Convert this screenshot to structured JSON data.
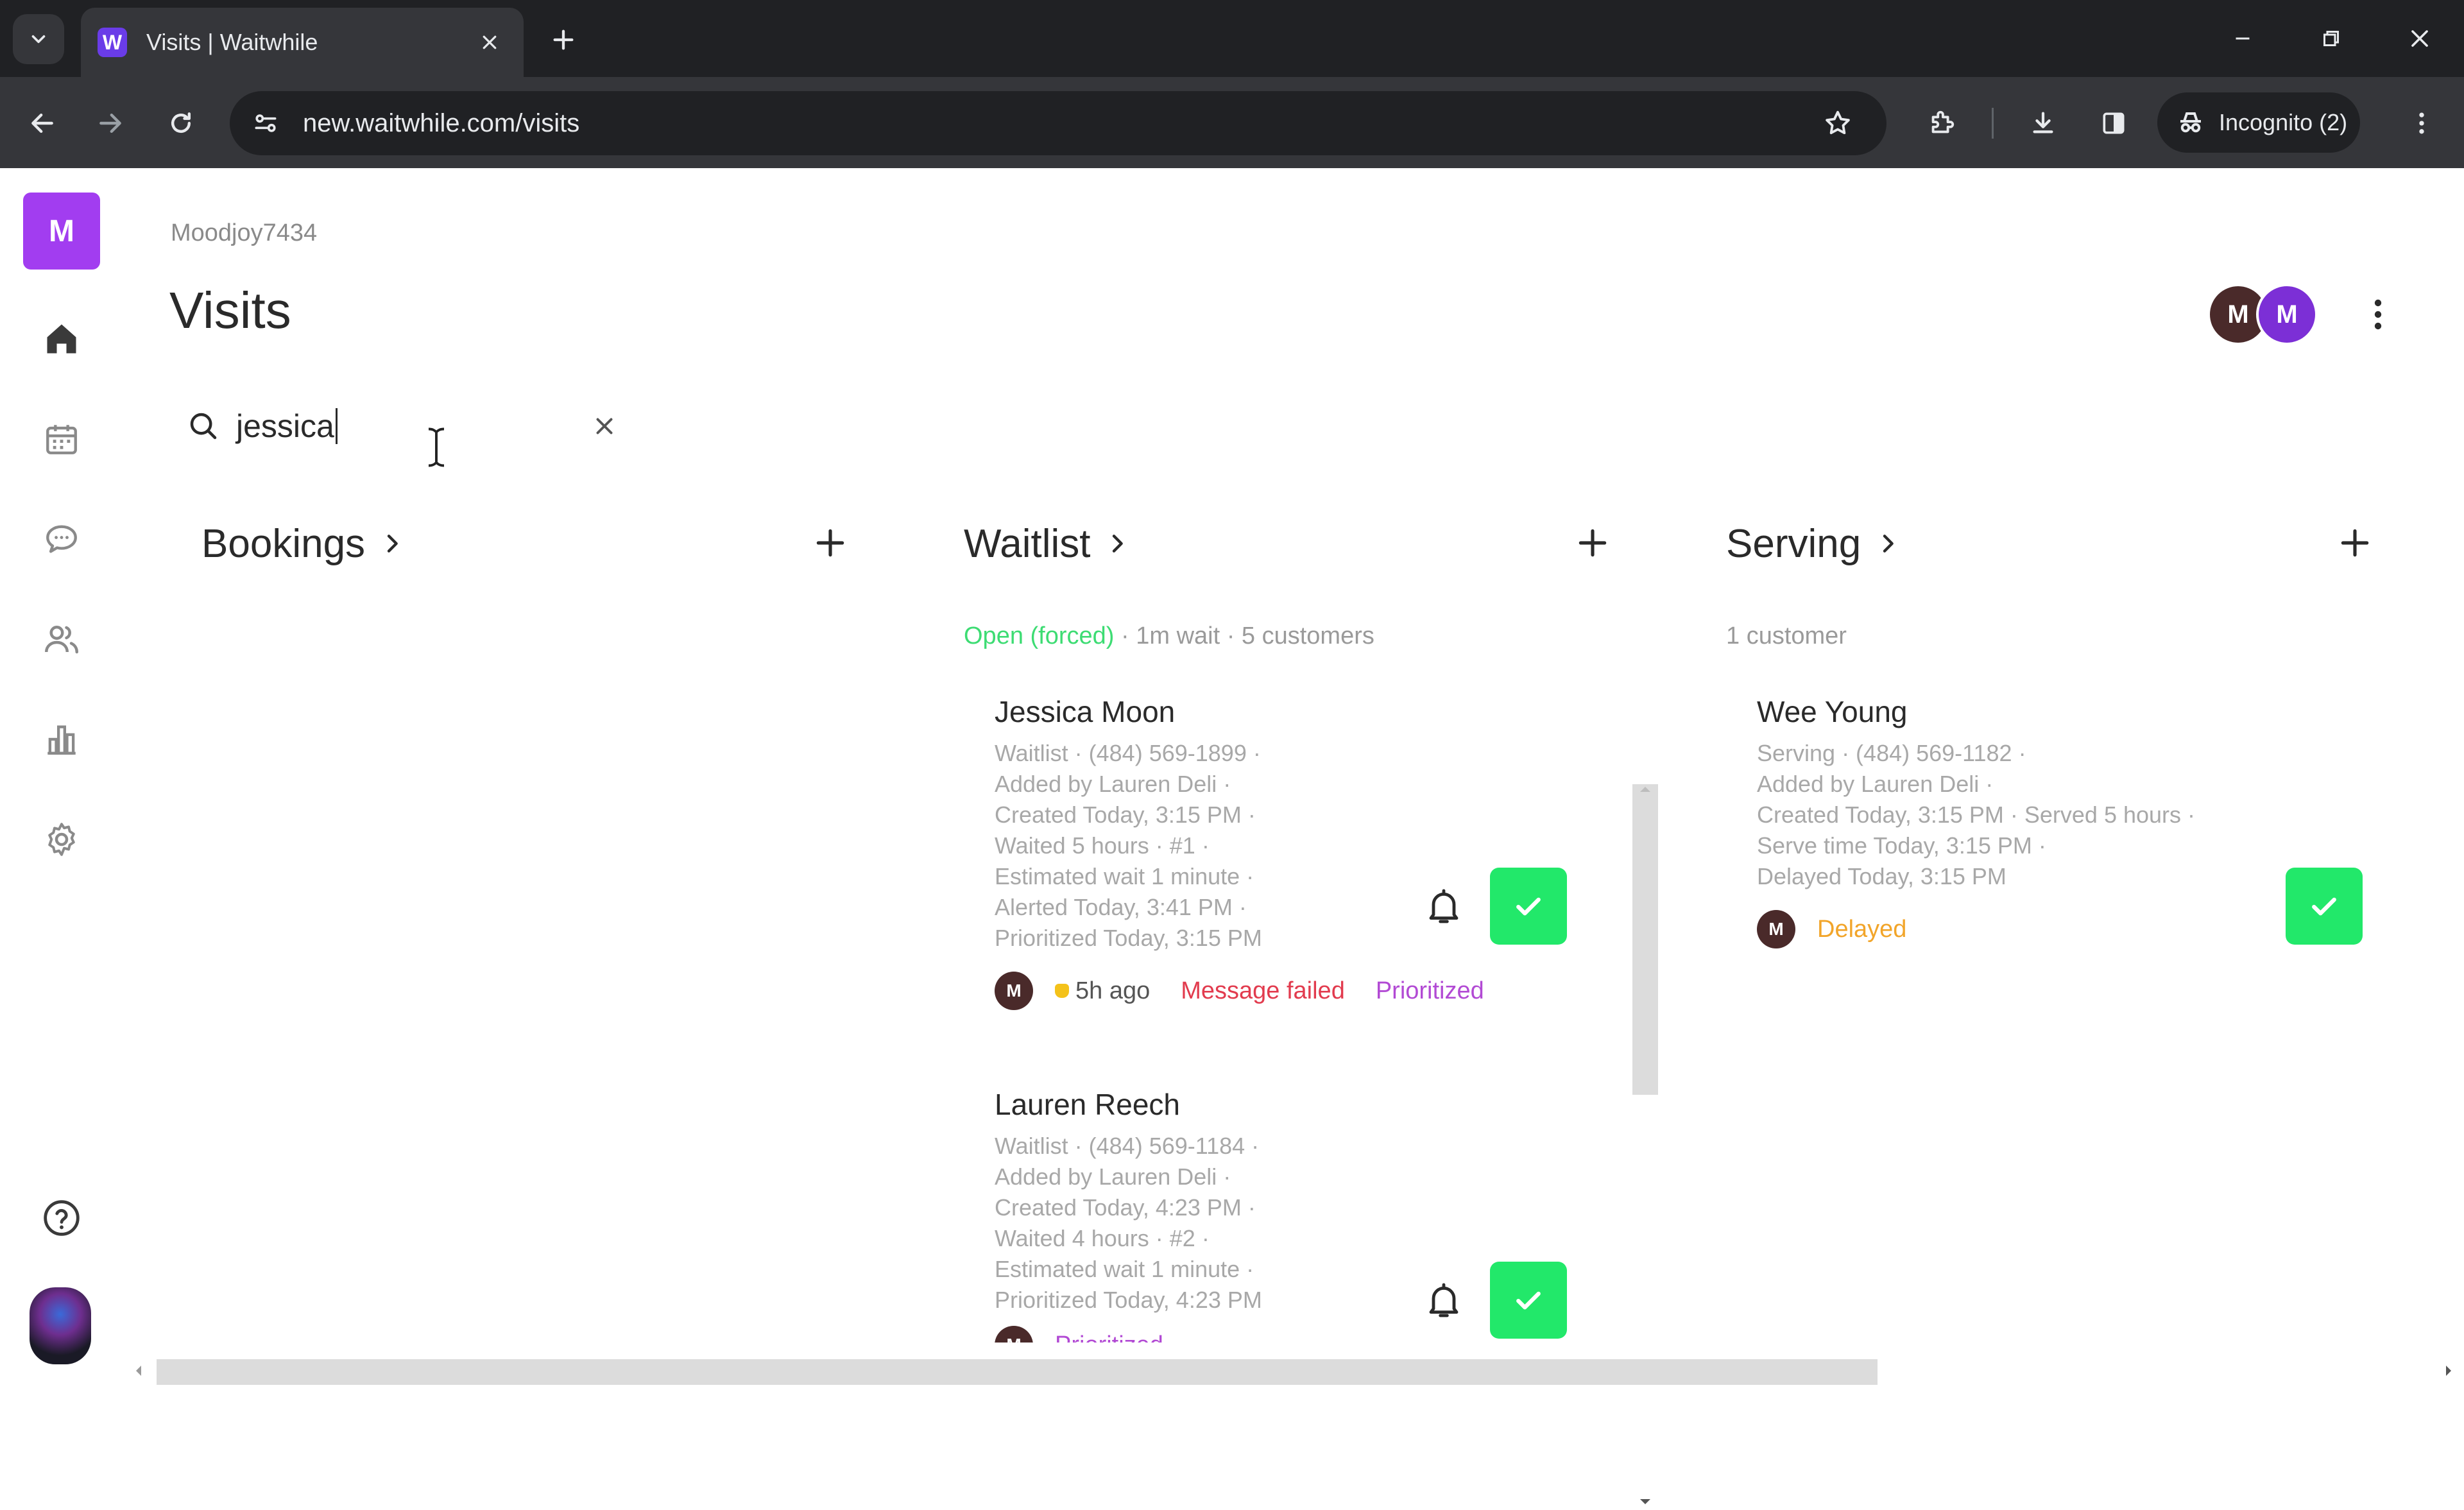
{
  "browser": {
    "tab_title": "Visits | Waitwhile",
    "favicon_letter": "W",
    "url": "new.waitwhile.com/visits",
    "incognito_label": "Incognito (2)"
  },
  "sidebar": {
    "org_initial": "M",
    "icons": [
      "home-icon",
      "calendar-icon",
      "chat-icon",
      "customers-icon",
      "analytics-icon",
      "settings-icon",
      "help-icon"
    ]
  },
  "header": {
    "org_name": "Moodjoy7434",
    "title": "Visits",
    "avatars": [
      {
        "initial": "M",
        "color": "#4a2a2a"
      },
      {
        "initial": "M",
        "color": "#7c2fd6"
      }
    ]
  },
  "search": {
    "value": "jessica"
  },
  "columns": {
    "bookings": {
      "title": "Bookings"
    },
    "waitlist": {
      "title": "Waitlist",
      "status": "Open (forced)",
      "summary_rest": " · 1m wait · 5 customers"
    },
    "serving": {
      "title": "Serving",
      "summary": "1 customer"
    }
  },
  "waitlist_cards": [
    {
      "name": "Jessica Moon",
      "lines": [
        "Waitlist · (484) 569-1899 ·",
        "Added by Lauren Deli ·",
        "Created Today, 3:15 PM ·",
        "Waited 5 hours · #1 ·",
        "Estimated wait 1 minute ·",
        "Alerted Today, 3:41 PM ·",
        "Prioritized Today, 3:15 PM"
      ],
      "avatar": "M",
      "ago": "5h ago",
      "failed": "Message failed",
      "prioritized": "Prioritized"
    },
    {
      "name": "Lauren Reech",
      "lines": [
        "Waitlist · (484) 569-1184 ·",
        "Added by Lauren Deli ·",
        "Created Today, 4:23 PM ·",
        "Waited 4 hours · #2 ·",
        "Estimated wait 1 minute ·",
        "Prioritized Today, 4:23 PM"
      ],
      "avatar": "M",
      "prioritized": "Prioritized"
    }
  ],
  "serving_cards": [
    {
      "name": "Wee Young",
      "lines": [
        "Serving · (484) 569-1182 ·",
        "Added by Lauren Deli ·",
        "Created Today, 3:15 PM · Served 5 hours ·",
        "Serve time Today, 3:15 PM ·",
        "Delayed Today, 3:15 PM"
      ],
      "avatar": "M",
      "delayed": "Delayed"
    }
  ],
  "colors": {
    "brand": "#a23df0",
    "check_green": "#22e86a",
    "open_green": "#3ddc73",
    "failed_red": "#e23b4e",
    "prioritized_purple": "#b24ad4",
    "delayed_orange": "#f2a52a"
  }
}
